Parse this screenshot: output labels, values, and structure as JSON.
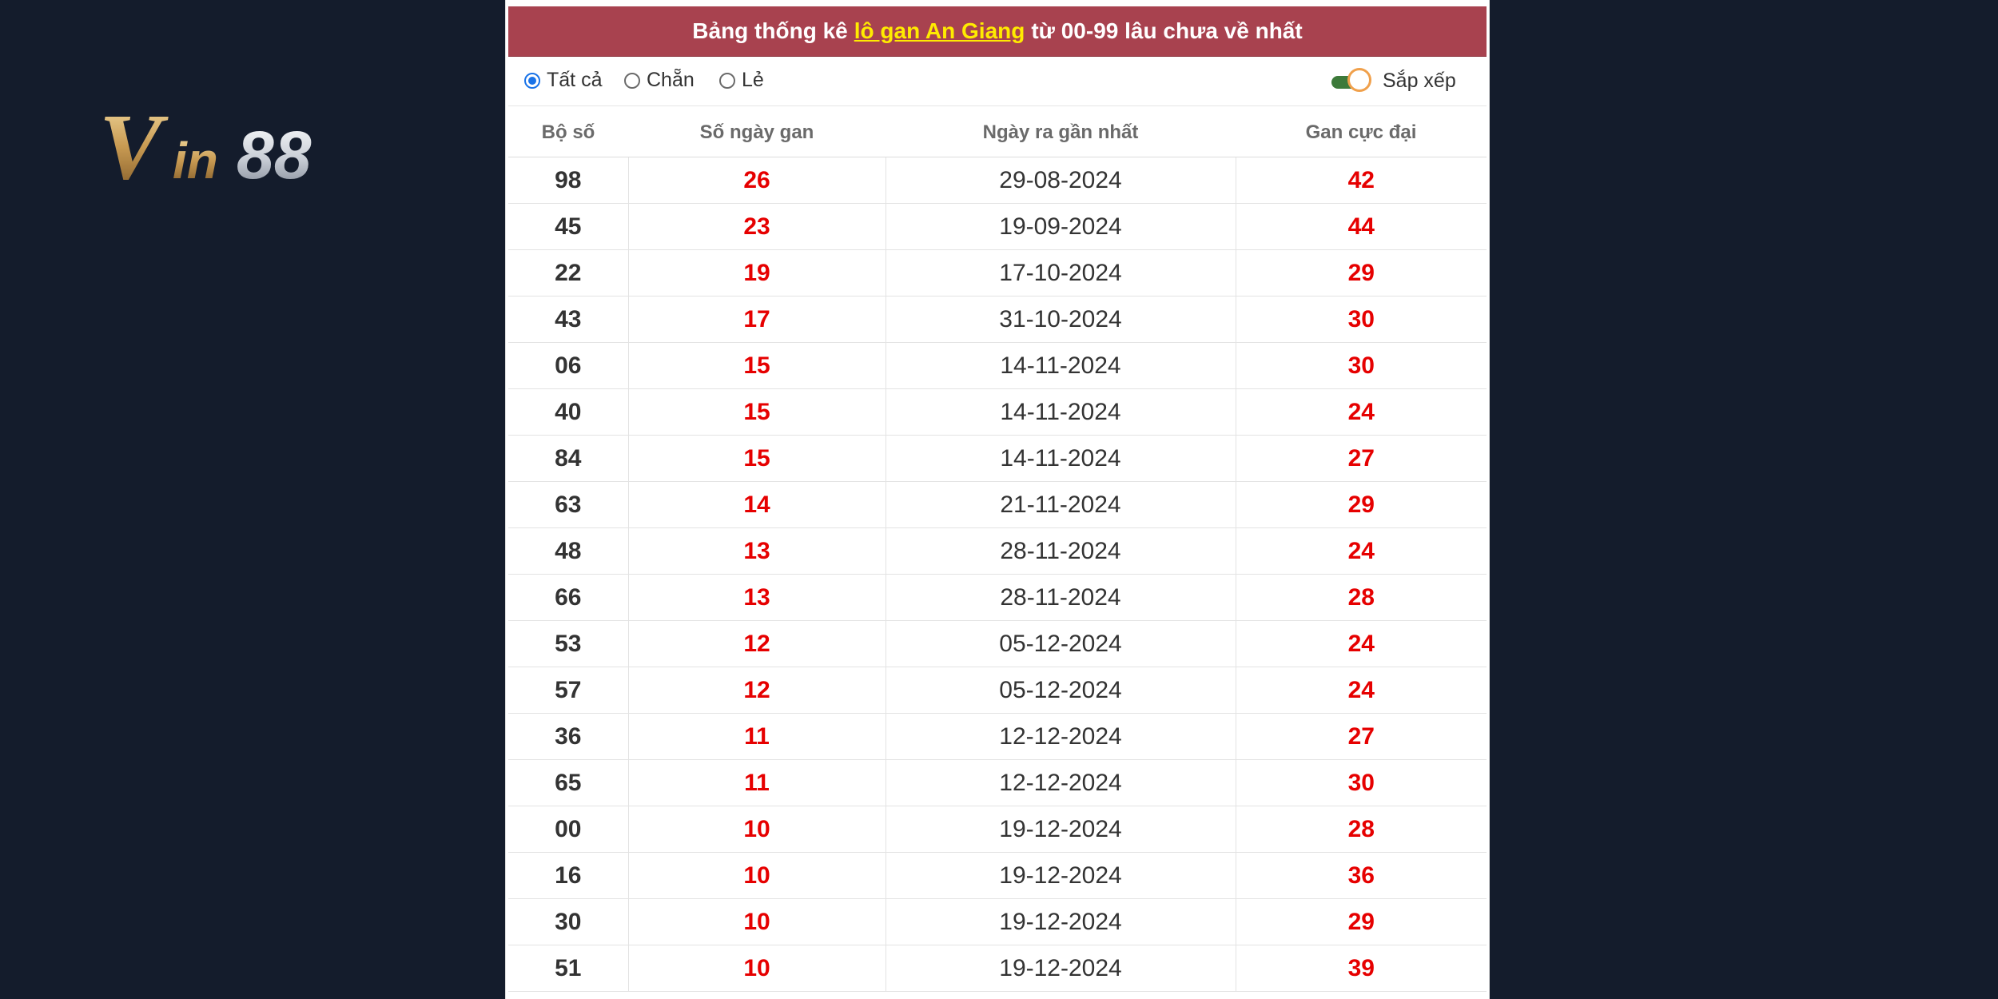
{
  "logo": {
    "text": "Vin88"
  },
  "title": {
    "prefix": "Bảng thống kê",
    "highlight": "lô gan An Giang",
    "suffix": "từ 00-99 lâu chưa về nhất"
  },
  "filters": {
    "options": [
      {
        "label": "Tất cả",
        "checked": true
      },
      {
        "label": "Chẵn",
        "checked": false
      },
      {
        "label": "Lẻ",
        "checked": false
      }
    ],
    "sort_label": "Sắp xếp",
    "sort_on": true
  },
  "table": {
    "headers": [
      "Bộ số",
      "Số ngày gan",
      "Ngày ra gần nhất",
      "Gan cực đại"
    ],
    "rows": [
      [
        "98",
        "26",
        "29-08-2024",
        "42"
      ],
      [
        "45",
        "23",
        "19-09-2024",
        "44"
      ],
      [
        "22",
        "19",
        "17-10-2024",
        "29"
      ],
      [
        "43",
        "17",
        "31-10-2024",
        "30"
      ],
      [
        "06",
        "15",
        "14-11-2024",
        "30"
      ],
      [
        "40",
        "15",
        "14-11-2024",
        "24"
      ],
      [
        "84",
        "15",
        "14-11-2024",
        "27"
      ],
      [
        "63",
        "14",
        "21-11-2024",
        "29"
      ],
      [
        "48",
        "13",
        "28-11-2024",
        "24"
      ],
      [
        "66",
        "13",
        "28-11-2024",
        "28"
      ],
      [
        "53",
        "12",
        "05-12-2024",
        "24"
      ],
      [
        "57",
        "12",
        "05-12-2024",
        "24"
      ],
      [
        "36",
        "11",
        "12-12-2024",
        "27"
      ],
      [
        "65",
        "11",
        "12-12-2024",
        "30"
      ],
      [
        "00",
        "10",
        "19-12-2024",
        "28"
      ],
      [
        "16",
        "10",
        "19-12-2024",
        "36"
      ],
      [
        "30",
        "10",
        "19-12-2024",
        "29"
      ],
      [
        "51",
        "10",
        "19-12-2024",
        "39"
      ]
    ]
  },
  "colors": {
    "page_bg": "#141c2c",
    "title_bg": "#a8424f",
    "highlight": "#ffeb00",
    "value_red": "#e60000",
    "toggle_track": "#3d7a3a",
    "toggle_ring": "#f0a04b"
  }
}
